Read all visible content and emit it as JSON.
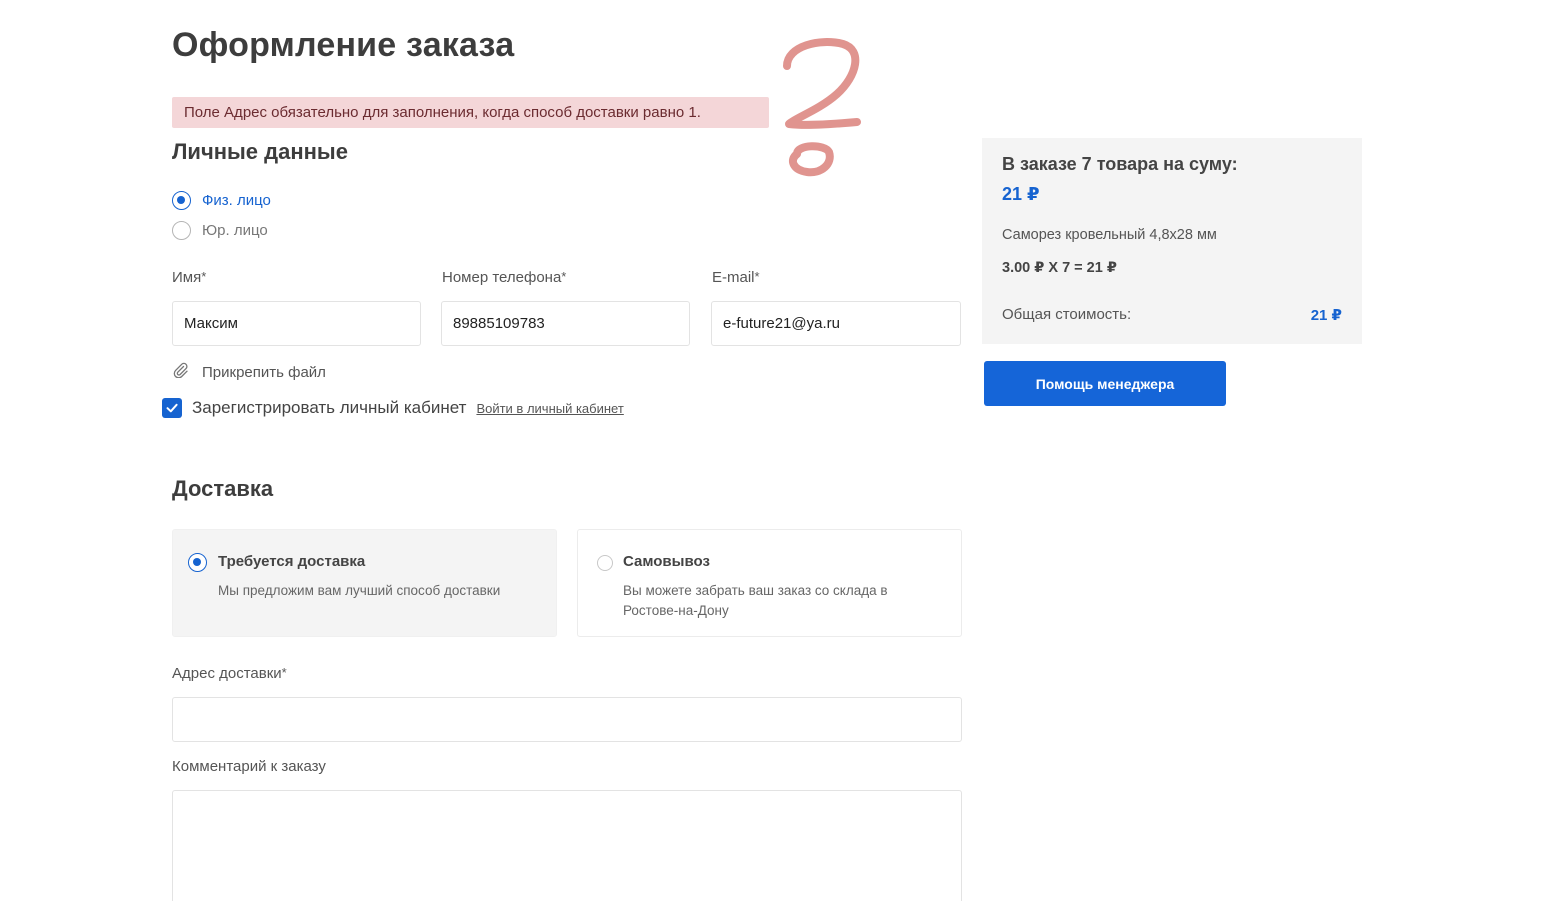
{
  "page": {
    "title": "Оформление заказа",
    "error_message": "Поле Адрес обязательно для заполнения, когда способ доставки равно 1."
  },
  "personal": {
    "heading": "Личные данные",
    "person_types": [
      {
        "label": "Физ. лицо",
        "selected": true
      },
      {
        "label": "Юр. лицо",
        "selected": false
      }
    ],
    "fields": {
      "name": {
        "label": "Имя",
        "required_mark": "*",
        "value": "Максим"
      },
      "phone": {
        "label": "Номер телефона",
        "required_mark": "*",
        "value": "89885109783"
      },
      "email": {
        "label": "E-mail",
        "required_mark": "*",
        "value": "e-future21@ya.ru"
      }
    },
    "attach_label": "Прикрепить файл",
    "register": {
      "label": "Зарегистрировать личный кабинет",
      "checked": true
    },
    "login_link": "Войти в личный кабинет"
  },
  "delivery": {
    "heading": "Доставка",
    "options": [
      {
        "title": "Требуется доставка",
        "description": "Мы предложим вам лучший способ доставки",
        "selected": true
      },
      {
        "title": "Самовывоз",
        "description": "Вы можете забрать ваш заказ со склада в Ростове-на-Дону",
        "selected": false
      }
    ],
    "address": {
      "label": "Адрес доставки",
      "required_mark": "*",
      "value": ""
    },
    "comment": {
      "label": "Комментарий к заказу",
      "value": ""
    }
  },
  "summary": {
    "title": "В заказе 7 товара на суму:",
    "total_top": "21 ₽",
    "item_name": "Саморез кровельный 4,8х28 мм",
    "item_calc": "3.00 ₽ X 7 = 21 ₽",
    "cost_label": "Общая стоимость:",
    "cost_value": "21 ₽"
  },
  "help_button": "Помощь менеджера",
  "colors": {
    "accent": "#1663d0",
    "error_bg": "#f4d6d8",
    "panel_bg": "#f4f4f4",
    "annotation": "#e0948f"
  },
  "icons": {
    "attach": "paperclip-icon",
    "checkbox": "checkmark-icon"
  }
}
